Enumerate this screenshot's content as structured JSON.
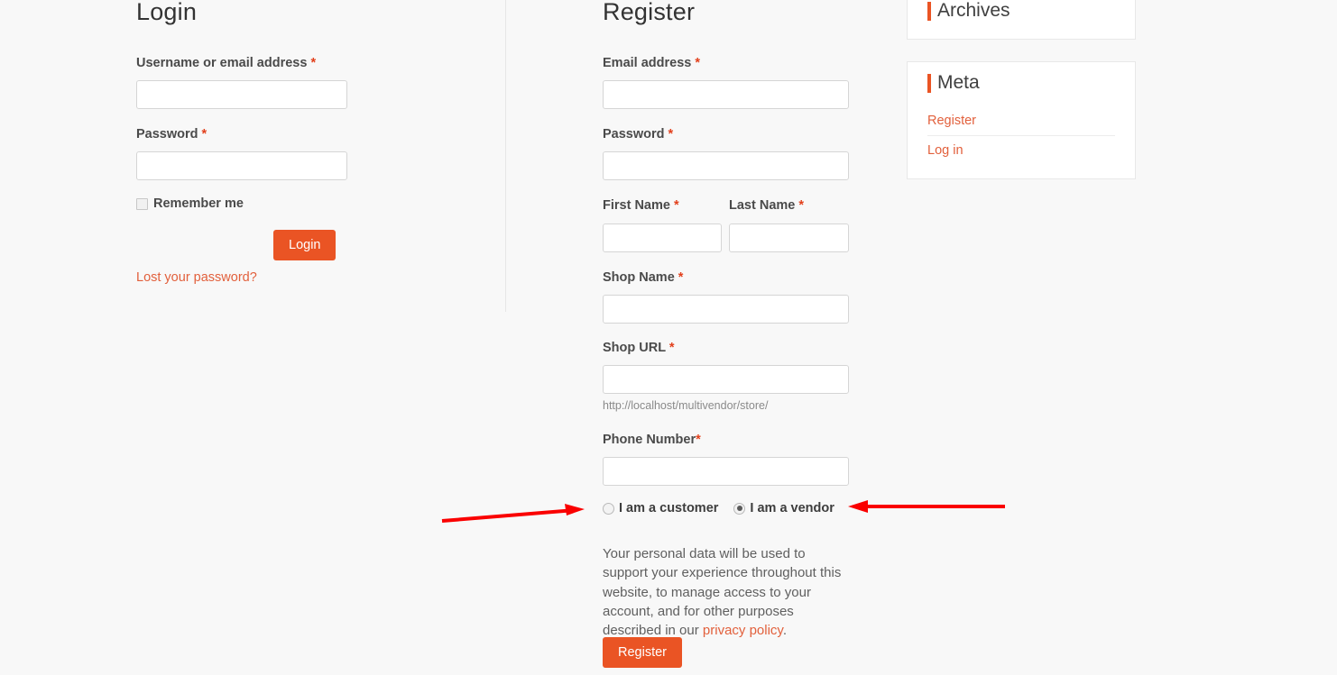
{
  "login": {
    "title": "Login",
    "username_label": "Username or email address",
    "username_value": "",
    "password_label": "Password",
    "password_value": "",
    "required_mark": "*",
    "remember_label": "Remember me",
    "remember_checked": false,
    "submit_label": "Login",
    "lost_password_label": "Lost your password?"
  },
  "register": {
    "title": "Register",
    "required_mark": "*",
    "email_label": "Email address",
    "email_value": "",
    "password_label": "Password",
    "password_value": "",
    "first_name_label": "First Name",
    "first_name_value": "",
    "last_name_label": "Last Name",
    "last_name_value": "",
    "shop_name_label": "Shop Name",
    "shop_name_value": "",
    "shop_url_label": "Shop URL",
    "shop_url_value": "",
    "shop_url_hint": "http://localhost/multivendor/store/",
    "phone_label": "Phone Number",
    "phone_value": "",
    "role_customer_label": "I am a customer",
    "role_vendor_label": "I am a vendor",
    "role_selected": "vendor",
    "privacy_text_before": "Your personal data will be used to support your experience throughout this website, to manage access to your account, and for other purposes described in our ",
    "privacy_link_label": "privacy policy",
    "privacy_text_after": ".",
    "submit_label": "Register"
  },
  "sidebar": {
    "widgets": [
      {
        "title": "Archives",
        "items": []
      },
      {
        "title": "Meta",
        "items": [
          {
            "label": "Register"
          },
          {
            "label": "Log in"
          }
        ]
      }
    ]
  },
  "annotations": {
    "left_arrow_name": "arrow-pointing-to-customer-radio",
    "right_arrow_name": "arrow-pointing-to-vendor-radio",
    "color": "#fa0000"
  },
  "colors": {
    "accent": "#ea5424",
    "link": "#e2603c",
    "required": "#e2401c",
    "page_background": "#f8f8f8"
  }
}
